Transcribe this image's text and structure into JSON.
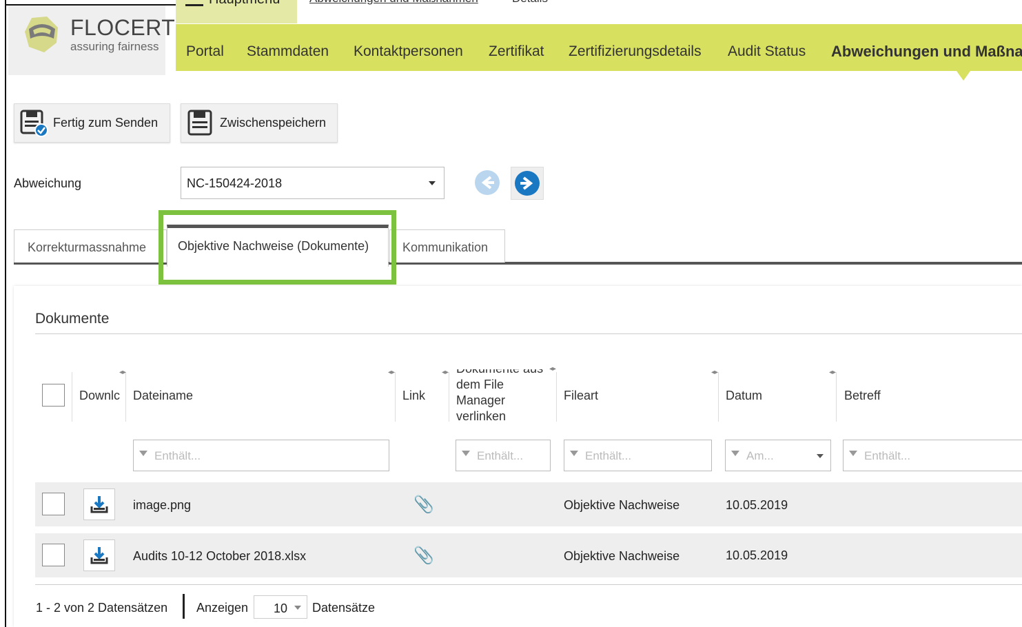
{
  "colors": {
    "nav_bg": "#d7e05f",
    "highlight": "#7dc23e",
    "accent_blue": "#1a78c2"
  },
  "logo": {
    "name": "FLOCERT",
    "tagline": "assuring fairness"
  },
  "breadcrumb": {
    "menu": "Hauptmenü",
    "link": "Abweichungen und Maßnahmen",
    "current": "Details"
  },
  "nav": {
    "items": [
      "Portal",
      "Stammdaten",
      "Kontaktpersonen",
      "Zertifikat",
      "Zertifizierungsdetails",
      "Audit Status",
      "Abweichungen und Maßnahmen"
    ],
    "active_index": 6
  },
  "toolbar": {
    "send_label": "Fertig zum Senden",
    "save_label": "Zwischenspeichern"
  },
  "deviation": {
    "label": "Abweichung",
    "selected": "NC-150424-2018"
  },
  "tabs": [
    "Korrekturmassnahme",
    "Objektive Nachweise (Dokumente)",
    "Kommunikation"
  ],
  "documents": {
    "title": "Dokumente",
    "columns": {
      "download": "Downlc",
      "filename": "Dateiname",
      "link": "Link",
      "filemanager": "Dokumente aus dem File Manager verlinken",
      "filetype": "Fileart",
      "date": "Datum",
      "subject": "Betreff"
    },
    "filters": {
      "filename": "Enthält...",
      "filemanager": "Enthält...",
      "filetype": "Enthält...",
      "date": "Am...",
      "subject": "Enthält..."
    },
    "rows": [
      {
        "filename": "image.png",
        "filetype": "Objektive Nachweise",
        "date": "10.05.2019"
      },
      {
        "filename": "Audits 10-12 October 2018.xlsx",
        "filetype": "Objektive Nachweise",
        "date": "10.05.2019"
      }
    ]
  },
  "pager": {
    "summary": "1 - 2 von 2 Datensätzen",
    "show_label": "Anzeigen",
    "page_size": "10",
    "records_label": "Datensätze"
  }
}
